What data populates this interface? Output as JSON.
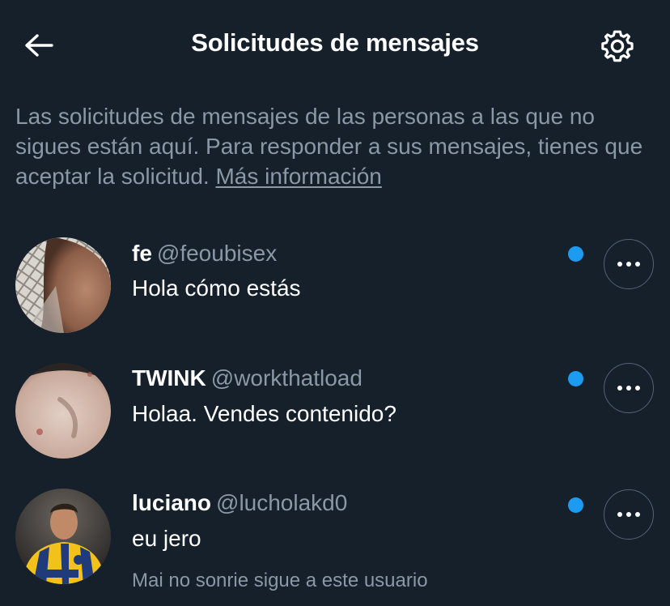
{
  "header": {
    "title": "Solicitudes de mensajes",
    "back_icon": "arrow-left-icon",
    "settings_icon": "gear-icon"
  },
  "info": {
    "text": "Las solicitudes de mensajes de las personas a las que no sigues están aquí. Para responder a sus mensajes, tienes que aceptar la solicitud.",
    "link_label": "Más información"
  },
  "requests": [
    {
      "display_name": "fe",
      "handle": "@feoubisex",
      "message": "Hola cómo estás",
      "unread": true
    },
    {
      "display_name": "TWINK",
      "handle": "@workthatload",
      "message": "Holaa. Vendes contenido?",
      "unread": true
    },
    {
      "display_name": "luciano",
      "handle": "@lucholakd0",
      "message": "eu jero",
      "note": "Mai no sonrie sigue a este usuario",
      "unread": true
    }
  ],
  "colors": {
    "background": "#15202b",
    "secondary_text": "#8b98a5",
    "accent": "#1d9bf0",
    "border": "#536471"
  }
}
